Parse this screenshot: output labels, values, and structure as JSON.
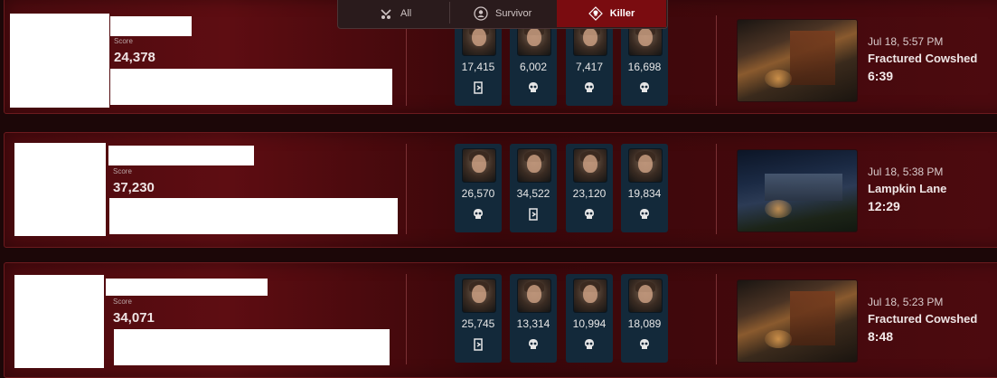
{
  "filters": {
    "tabs": [
      {
        "label": "All",
        "active": false,
        "icon": "all-icon"
      },
      {
        "label": "Survivor",
        "active": false,
        "icon": "survivor-icon"
      },
      {
        "label": "Killer",
        "active": true,
        "icon": "killer-icon"
      }
    ]
  },
  "matches": [
    {
      "score_label": "Score",
      "score": "24,378",
      "players": [
        {
          "score": "17,415",
          "status": "escaped"
        },
        {
          "score": "6,002",
          "status": "killed"
        },
        {
          "score": "7,417",
          "status": "killed"
        },
        {
          "score": "16,698",
          "status": "killed"
        }
      ],
      "time": "Jul 18, 5:57 PM",
      "map": "Fractured Cowshed",
      "duration": "6:39"
    },
    {
      "score_label": "Score",
      "score": "37,230",
      "players": [
        {
          "score": "26,570",
          "status": "killed"
        },
        {
          "score": "34,522",
          "status": "escaped"
        },
        {
          "score": "23,120",
          "status": "killed"
        },
        {
          "score": "19,834",
          "status": "killed"
        }
      ],
      "time": "Jul 18, 5:38 PM",
      "map": "Lampkin Lane",
      "duration": "12:29"
    },
    {
      "score_label": "Score",
      "score": "34,071",
      "players": [
        {
          "score": "25,745",
          "status": "escaped"
        },
        {
          "score": "13,314",
          "status": "killed"
        },
        {
          "score": "10,994",
          "status": "killed"
        },
        {
          "score": "18,089",
          "status": "killed"
        }
      ],
      "time": "Jul 18, 5:23 PM",
      "map": "Fractured Cowshed",
      "duration": "8:48"
    }
  ],
  "colors": {
    "card": "#4a0a0e",
    "player_tile": "#13293a",
    "active_tab": "#7a0c10"
  }
}
